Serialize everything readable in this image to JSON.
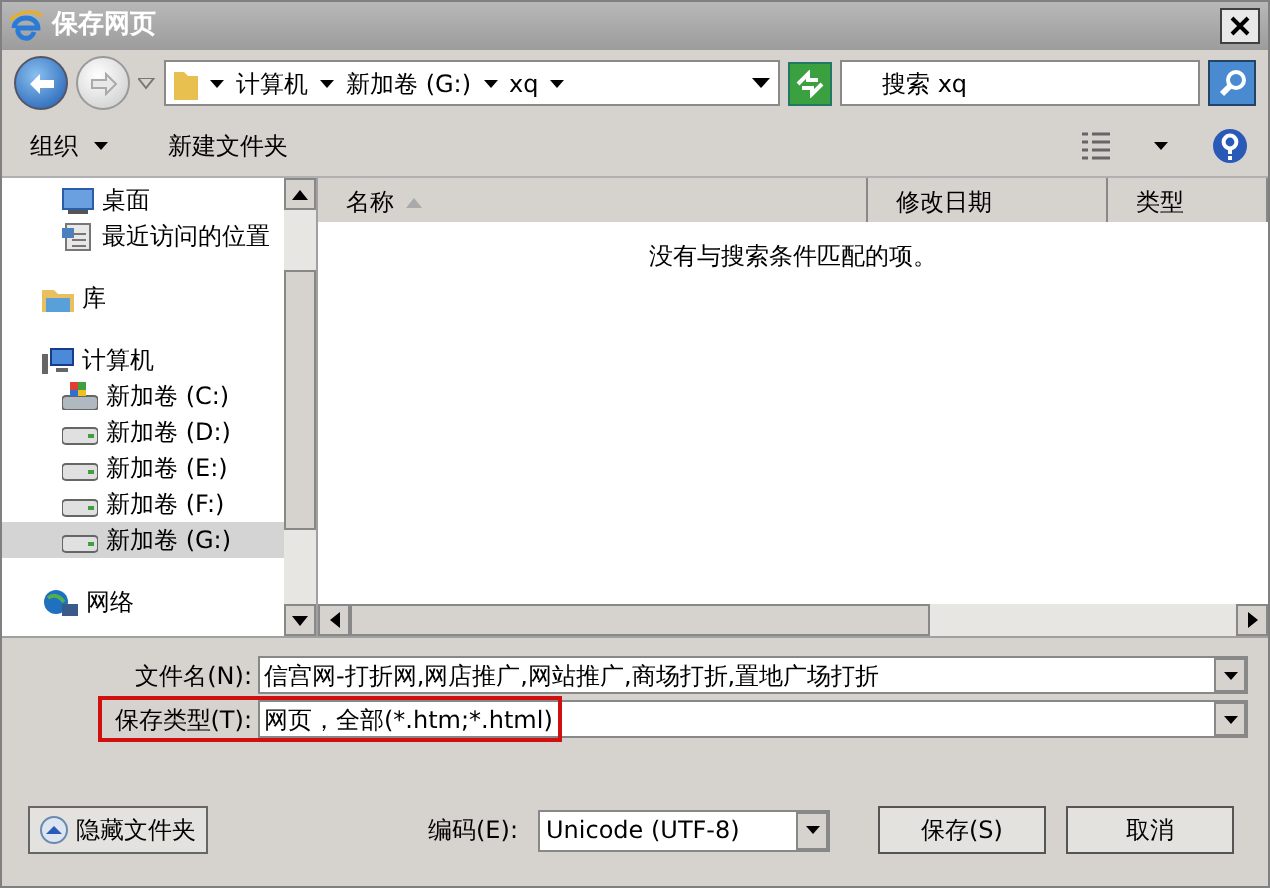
{
  "window": {
    "title": "保存网页"
  },
  "address": {
    "crumbs": [
      "计算机",
      "新加卷 (G:)",
      "xq"
    ]
  },
  "search": {
    "placeholder": "搜索 xq"
  },
  "toolbar": {
    "items": [
      {
        "label": "组织",
        "dropdown": true
      },
      {
        "label": "新建文件夹",
        "dropdown": false
      }
    ]
  },
  "nav": {
    "groups": [
      {
        "children": [
          {
            "label": "桌面",
            "kind": "desktop",
            "selected": false
          },
          {
            "label": "最近访问的位置",
            "kind": "recent",
            "selected": false
          }
        ]
      },
      {
        "label": "库",
        "kind": "library",
        "selected": false
      },
      {
        "label": "计算机",
        "kind": "computer",
        "selected": false,
        "children": [
          {
            "label": "新加卷 (C:)",
            "kind": "system-drive",
            "selected": false
          },
          {
            "label": "新加卷 (D:)",
            "kind": "drive",
            "selected": false
          },
          {
            "label": "新加卷 (E:)",
            "kind": "drive",
            "selected": false
          },
          {
            "label": "新加卷 (F:)",
            "kind": "drive",
            "selected": false
          },
          {
            "label": "新加卷 (G:)",
            "kind": "drive",
            "selected": true
          }
        ]
      },
      {
        "label": "网络",
        "kind": "network",
        "selected": false
      }
    ]
  },
  "table": {
    "columns": [
      {
        "label": "名称",
        "sorted": true
      },
      {
        "label": "修改日期",
        "sorted": false
      },
      {
        "label": "类型",
        "sorted": false
      }
    ],
    "empty_message": "没有与搜索条件匹配的项。"
  },
  "form": {
    "fields": [
      {
        "label": "文件名(N):",
        "value": "信宫网-打折网,网店推广,网站推广,商场打折,置地广场打折",
        "highlighted": false
      },
      {
        "label": "保存类型(T):",
        "value": "网页，全部(*.htm;*.html)",
        "highlighted": true
      }
    ],
    "encoding": {
      "label": "编码(E):",
      "value": "Unicode (UTF-8)"
    },
    "hide_folders": "隐藏文件夹",
    "buttons": [
      "保存(S)",
      "取消"
    ]
  }
}
